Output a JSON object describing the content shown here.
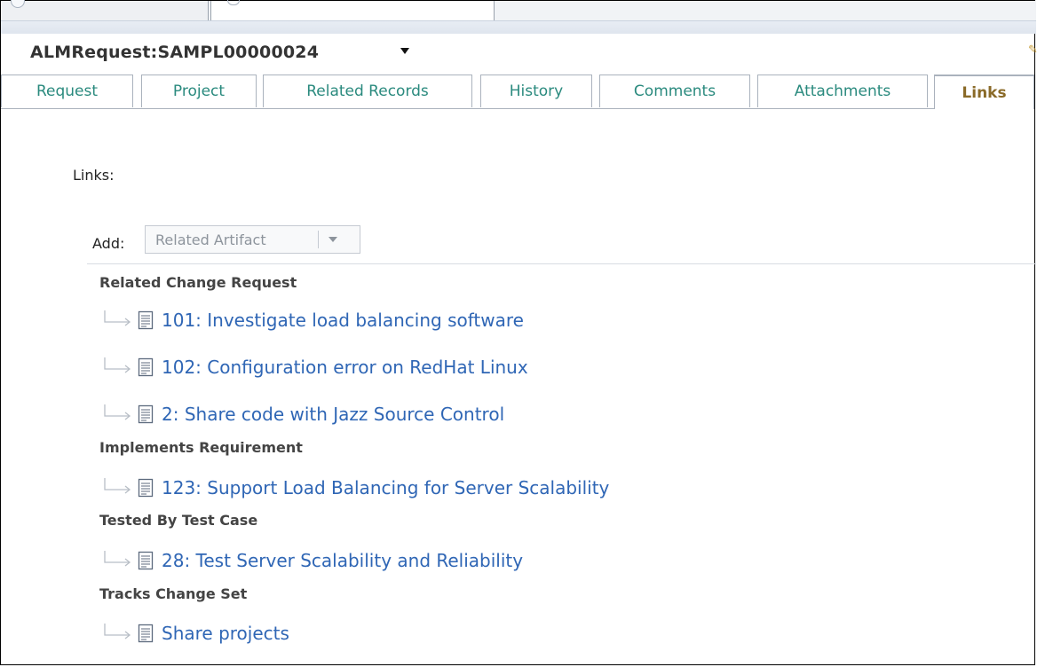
{
  "record": {
    "title": "ALMRequest:SAMPL00000024"
  },
  "tabs": [
    {
      "label": "Request"
    },
    {
      "label": "Project"
    },
    {
      "label": "Related Records"
    },
    {
      "label": "History"
    },
    {
      "label": "Comments"
    },
    {
      "label": "Attachments"
    },
    {
      "label": "Links",
      "active": true
    }
  ],
  "links_panel": {
    "heading": "Links:",
    "add_label": "Add:",
    "add_selector": "Related Artifact",
    "groups": [
      {
        "name": "Related Change Request",
        "items": [
          "101: Investigate load balancing software",
          "102: Configuration error on RedHat Linux",
          "2: Share code with Jazz Source Control"
        ]
      },
      {
        "name": "Implements Requirement",
        "items": [
          "123: Support Load Balancing for Server Scalability"
        ]
      },
      {
        "name": "Tested By Test Case",
        "items": [
          "28: Test Server Scalability and Reliability"
        ]
      },
      {
        "name": "Tracks Change Set",
        "items": [
          "Share projects"
        ]
      }
    ]
  },
  "colors": {
    "link": "#2f66b5",
    "tab_text": "#2a8a7e",
    "active_tab_text": "#8a6a28"
  },
  "icons": [
    "title-menu-caret-icon",
    "branch-arrow-icon",
    "document-icon",
    "dropdown-arrow-icon"
  ]
}
